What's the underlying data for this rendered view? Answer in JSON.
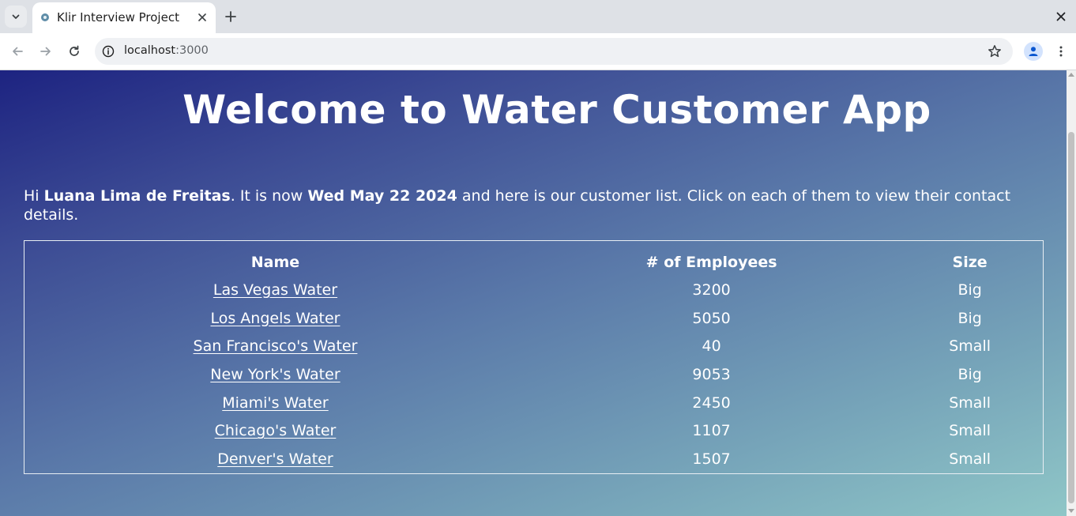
{
  "browser": {
    "tab_title": "Klir Interview Project",
    "url_host": "localhost",
    "url_port": ":3000"
  },
  "page": {
    "heading": "Welcome to Water Customer App",
    "greeting": {
      "prefix": "Hi ",
      "user_name": "Luana Lima de Freitas",
      "middle": ". It is now ",
      "date": "Wed May 22 2024",
      "suffix": " and here is our customer list. Click on each of them to view their contact details."
    },
    "table": {
      "headers": [
        "Name",
        "# of Employees",
        "Size"
      ],
      "rows": [
        {
          "name": "Las Vegas Water",
          "employees": "3200",
          "size": "Big"
        },
        {
          "name": "Los Angels Water",
          "employees": "5050",
          "size": "Big"
        },
        {
          "name": "San Francisco's Water",
          "employees": "40",
          "size": "Small"
        },
        {
          "name": "New York's Water",
          "employees": "9053",
          "size": "Big"
        },
        {
          "name": "Miami's Water",
          "employees": "2450",
          "size": "Small"
        },
        {
          "name": "Chicago's Water",
          "employees": "1107",
          "size": "Small"
        },
        {
          "name": "Denver's Water",
          "employees": "1507",
          "size": "Small"
        }
      ]
    }
  },
  "colors": {
    "gradient_start": "#1d2381",
    "gradient_end": "#8fc6c7",
    "text": "#ffffff"
  }
}
